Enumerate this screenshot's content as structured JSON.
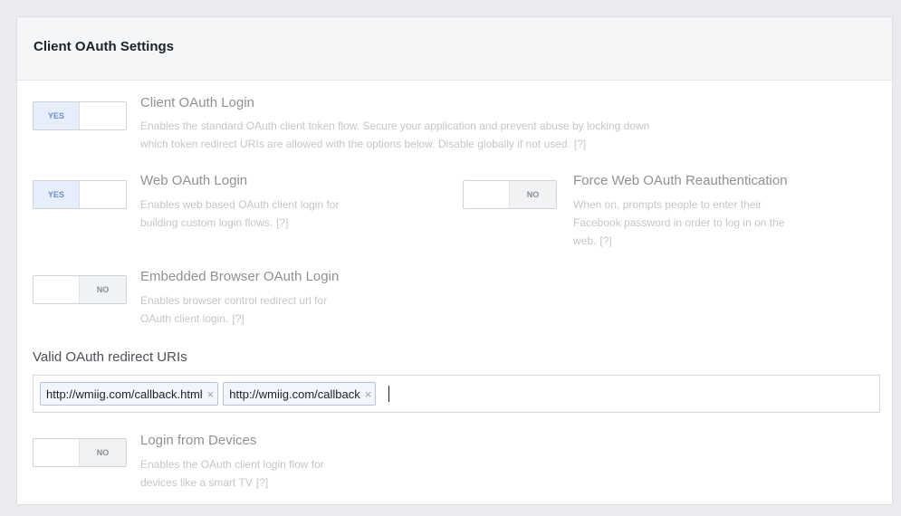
{
  "panel": {
    "title": "Client OAuth Settings"
  },
  "settings": {
    "client_oauth_login": {
      "title": "Client OAuth Login",
      "desc_line1": "Enables the standard OAuth client token flow. Secure your application and prevent abuse by locking down",
      "desc_line2": "which token redirect URIs are allowed with the options below. Disable globally if not used.",
      "help": "[?]",
      "toggle_label": "YES",
      "state": "on"
    },
    "web_oauth_login": {
      "title": "Web OAuth Login",
      "desc_line1": "Enables web based OAuth client login for",
      "desc_line2": "building custom login flows.",
      "help": "[?]",
      "toggle_label": "YES",
      "state": "on"
    },
    "force_web_oauth_reauth": {
      "title": "Force Web OAuth Reauthentication",
      "desc_line1": "When on, prompts people to enter their",
      "desc_line2": "Facebook password in order to log in on the",
      "desc_line3": "web.",
      "help": "[?]",
      "toggle_label": "NO",
      "state": "off"
    },
    "embedded_browser_oauth_login": {
      "title": "Embedded Browser OAuth Login",
      "desc_line1": "Enables browser control redirect url for",
      "desc_line2": "OAuth client login.",
      "help": "[?]",
      "toggle_label": "NO",
      "state": "off"
    },
    "login_from_devices": {
      "title": "Login from Devices",
      "desc_line1": "Enables the OAuth client login flow for",
      "desc_line2": "devices like a smart TV",
      "help": "[?]",
      "toggle_label": "NO",
      "state": "off"
    }
  },
  "redirect_uris": {
    "label": "Valid OAuth redirect URIs",
    "tokens": [
      "http://wmiig.com/callback.html",
      "http://wmiig.com/callback"
    ],
    "remove_glyph": "×"
  },
  "colors": {
    "yes_toggle_fill": "#e7eefb",
    "chip_border": "#b7c3dd"
  }
}
